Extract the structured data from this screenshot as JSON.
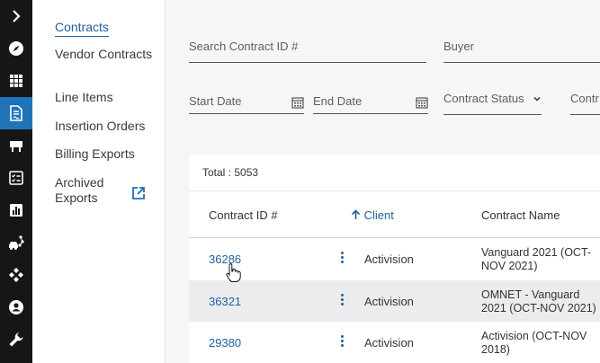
{
  "rail": {
    "items": [
      {
        "icon": "chevron-right-icon"
      },
      {
        "icon": "compass-icon"
      },
      {
        "icon": "grid-icon"
      },
      {
        "icon": "contract-document-icon",
        "active": true
      },
      {
        "icon": "billboard-icon"
      },
      {
        "icon": "checklist-icon"
      },
      {
        "icon": "bar-chart-icon"
      },
      {
        "icon": "car-network-icon"
      },
      {
        "icon": "diamond-arrows-icon"
      },
      {
        "icon": "user-circle-icon"
      },
      {
        "icon": "wrench-icon"
      }
    ]
  },
  "subnav": {
    "items": [
      {
        "label": "Contracts",
        "active": true
      },
      {
        "label": "Vendor Contracts"
      },
      {
        "label": "Line Items"
      },
      {
        "label": "Insertion Orders"
      },
      {
        "label": "Billing Exports"
      },
      {
        "label": "Archived Exports"
      }
    ]
  },
  "filters": {
    "search_contract": "Search Contract ID #",
    "buyer": "Buyer",
    "start_date": "Start Date",
    "end_date": "End Date",
    "contract_status": "Contract Status",
    "contract_more": "Contr"
  },
  "table": {
    "total": "Total : 5053",
    "headers": {
      "contract_id": "Contract ID #",
      "client": "Client",
      "contract_name": "Contract Name"
    },
    "rows": [
      {
        "id": "36286",
        "client": "Activision",
        "name": "Vanguard 2021 (OCT-NOV 2021)"
      },
      {
        "id": "36321",
        "client": "Activision",
        "name": "OMNET - Vanguard 2021 (OCT-NOV 2021)"
      },
      {
        "id": "29380",
        "client": "Activision",
        "name": "Activision (OCT-NOV 2018)"
      }
    ]
  },
  "colors": {
    "accent": "#1f73b7",
    "link": "#1f5f9e",
    "rail_bg": "#161616"
  }
}
